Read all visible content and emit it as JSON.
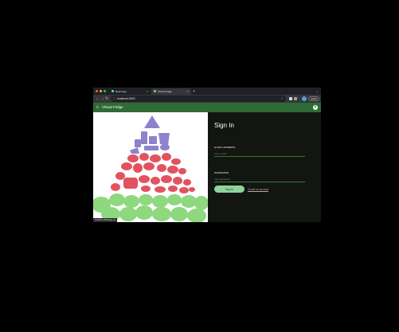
{
  "browser": {
    "tabs": [
      {
        "title": "React App",
        "favicon_color": "#61dafb",
        "active": false
      },
      {
        "title": "Virtual Fridge",
        "favicon_color": "#8fd49a",
        "active": true
      }
    ],
    "url": "localhost:3000",
    "update_label": "Update"
  },
  "app": {
    "title": "Virtual Fridge",
    "accent": "#2e6b35"
  },
  "signin": {
    "heading": "Sign In",
    "email_label": "E-MAIL ADDRESS",
    "email_placeholder": "Your e-mail",
    "password_label": "PASSWORD",
    "password_placeholder": "Your password",
    "submit_label": "Sign in",
    "create_account_label": "Create an account"
  },
  "status_bar": {
    "text": "localhost:3000/sign-up"
  },
  "colors": {
    "sweets": "#8e82cc",
    "protein": "#e2535f",
    "vegetables": "#8ed87f",
    "button": "#8fd49a"
  }
}
